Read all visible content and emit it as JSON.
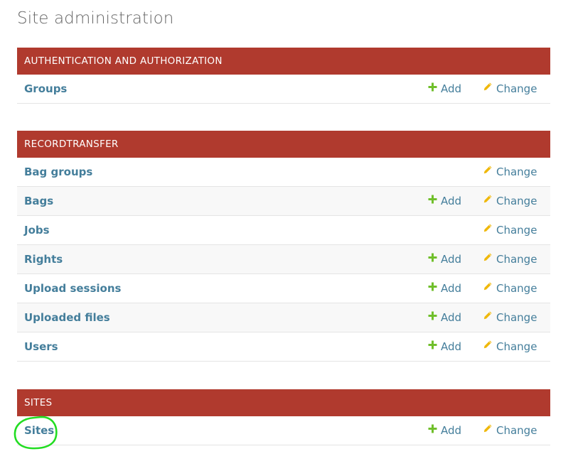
{
  "page": {
    "title": "Site administration"
  },
  "labels": {
    "add": "Add",
    "change": "Change"
  },
  "colors": {
    "header_bg": "#b03a2e",
    "link": "#447e9b",
    "add_icon": "#70bf2b",
    "change_icon": "#efb80b",
    "annotation": "#22dd22"
  },
  "modules": [
    {
      "title": "AUTHENTICATION AND AUTHORIZATION",
      "models": [
        {
          "name": "Groups",
          "has_add": true,
          "has_change": true
        }
      ]
    },
    {
      "title": "RECORDTRANSFER",
      "models": [
        {
          "name": "Bag groups",
          "has_add": false,
          "has_change": true
        },
        {
          "name": "Bags",
          "has_add": true,
          "has_change": true
        },
        {
          "name": "Jobs",
          "has_add": false,
          "has_change": true
        },
        {
          "name": "Rights",
          "has_add": true,
          "has_change": true
        },
        {
          "name": "Upload sessions",
          "has_add": true,
          "has_change": true
        },
        {
          "name": "Uploaded files",
          "has_add": true,
          "has_change": true
        },
        {
          "name": "Users",
          "has_add": true,
          "has_change": true
        }
      ]
    },
    {
      "title": "SITES",
      "models": [
        {
          "name": "Sites",
          "has_add": true,
          "has_change": true
        }
      ]
    }
  ],
  "icons": {
    "add": "plus-icon",
    "change": "pencil-icon"
  }
}
